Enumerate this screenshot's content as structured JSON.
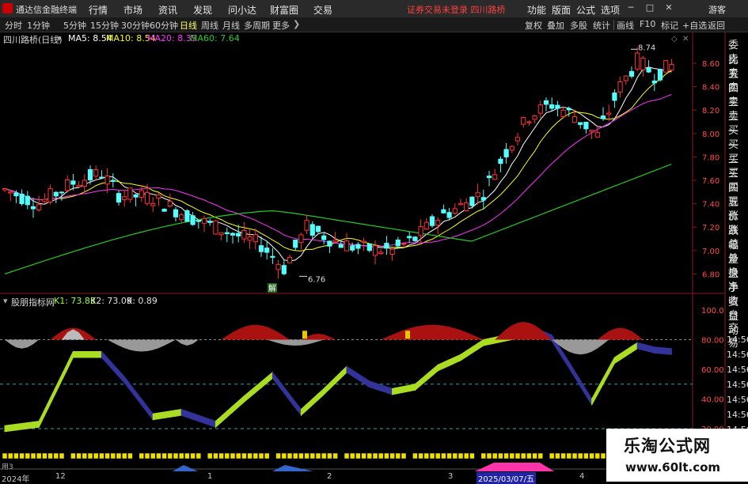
{
  "titlebar": {
    "app_title": "通达信金融终端",
    "menus": [
      "行情",
      "市场",
      "资讯",
      "发现",
      "问小达",
      "财富圈",
      "交易"
    ],
    "notice": "证券交易未登录  四川路桥",
    "right_menus": [
      "功能",
      "版面",
      "公式",
      "选项"
    ],
    "guest": "游客",
    "win_buttons": [
      "─",
      "□",
      "✕"
    ]
  },
  "toolbar": {
    "timeframes": [
      "分时",
      "1分钟",
      "5分钟",
      "15分钟",
      "30分钟",
      "60分钟",
      "日线",
      "周线",
      "月线",
      "多周期",
      "更多"
    ],
    "active": "日线",
    "right_buttons": [
      "复权",
      "叠加",
      "多股",
      "统计",
      "画线",
      "F10",
      "标记",
      "+自选",
      "返回"
    ]
  },
  "stock": {
    "name": "四川路桥(日线)"
  },
  "ma": [
    {
      "label": "MA5: 8.54",
      "color": "#ffffff"
    },
    {
      "label": "MA10: 8.54",
      "color": "#ffff00"
    },
    {
      "label": "MA20: 8.35",
      "color": "#ff33ff"
    },
    {
      "label": "MA60: 7.64",
      "color": "#22cc22"
    }
  ],
  "price_axis": [
    "8.60",
    "8.40",
    "8.20",
    "8.00",
    "7.80",
    "7.60",
    "7.40",
    "7.20",
    "7.00",
    "6.80"
  ],
  "annotations": {
    "high": "8.74",
    "low": "6.76",
    "jie": "解"
  },
  "indicator": {
    "name": "股朋指标网",
    "k1": "K1: 73.83",
    "k2": "K2: 73.09",
    "k": "K: 0.89",
    "axis": [
      "100.0",
      "80.00",
      "60.00",
      "40.00",
      "20.00"
    ]
  },
  "right_panel": [
    "委比",
    "卖五",
    "卖四",
    "卖三",
    "卖二",
    "卖一",
    "买一",
    "买二",
    "买三",
    "买四",
    "买五",
    "现价",
    "涨跌",
    "涨幅",
    "总量",
    "外盘",
    "换手",
    "净资",
    "收益",
    "自动",
    "交易"
  ],
  "times": [
    "14:56",
    "14:56",
    "14:56",
    "14:56",
    "14:56",
    "14:56",
    "14:56",
    "14:56"
  ],
  "dates": [
    "2024年",
    "12",
    "1",
    "2",
    "3",
    "2025/03/07/五",
    "4"
  ],
  "bottom_labels": {
    "yong": "用3"
  },
  "watermark": {
    "title": "乐淘公式网",
    "url": "www.60lt.com"
  },
  "colors": {
    "up": "#ff3232",
    "down": "#54ffff",
    "ma5": "#ffffff",
    "ma10": "#ffff00",
    "ma20": "#ff33ff",
    "ma60": "#22cc22"
  }
}
